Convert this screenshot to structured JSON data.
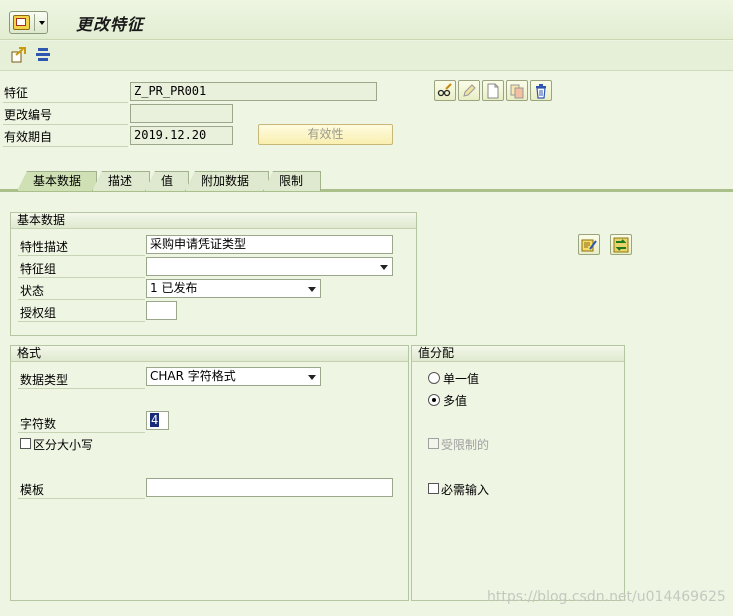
{
  "window": {
    "title": "更改特征"
  },
  "header": {
    "characteristic_label": "特征",
    "characteristic_value": "Z_PR_PR001",
    "change_number_label": "更改编号",
    "change_number_value": "",
    "valid_from_label": "有效期自",
    "valid_from_value": "2019.12.20",
    "validity_button": "有效性"
  },
  "tabs": [
    {
      "label": "基本数据",
      "active": true
    },
    {
      "label": "描述"
    },
    {
      "label": "值"
    },
    {
      "label": "附加数据"
    },
    {
      "label": "限制"
    }
  ],
  "basic_data": {
    "title": "基本数据",
    "description_label": "特性描述",
    "description_value": "采购申请凭证类型",
    "group_label": "特征组",
    "group_value": "",
    "status_label": "状态",
    "status_value": "1 已发布",
    "auth_group_label": "授权组",
    "auth_group_value": ""
  },
  "format": {
    "title": "格式",
    "data_type_label": "数据类型",
    "data_type_value": "CHAR 字符格式",
    "num_chars_label": "字符数",
    "num_chars_value": "4",
    "case_sensitive_label": "区分大小写",
    "template_label": "模板",
    "template_value": ""
  },
  "value_assignment": {
    "title": "值分配",
    "single_value_label": "单一值",
    "multi_value_label": "多值",
    "selected": "multi",
    "restricted_label": "受限制的",
    "required_label": "必需输入"
  },
  "watermark": "https://blog.csdn.net/u014469625"
}
